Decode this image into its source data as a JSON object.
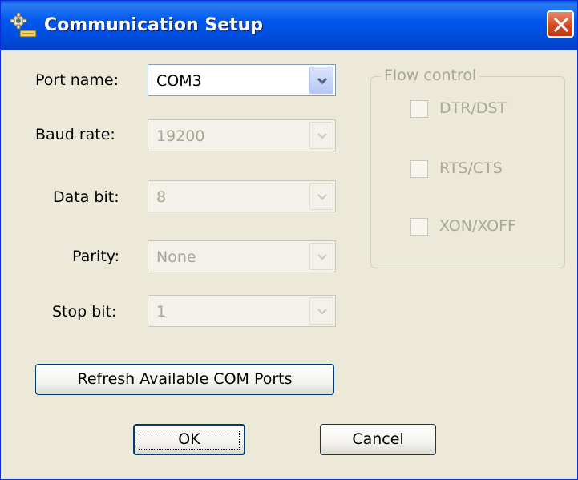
{
  "window": {
    "title": "Communication Setup",
    "title_icon": "settings-gear-icon",
    "close_icon": "close-icon"
  },
  "form": {
    "port_name": {
      "label": "Port name:",
      "value": "COM3",
      "enabled": true
    },
    "baud_rate": {
      "label": "Baud rate:",
      "value": "19200",
      "enabled": false
    },
    "data_bit": {
      "label": "Data bit:",
      "value": "8",
      "enabled": false
    },
    "parity": {
      "label": "Parity:",
      "value": "None",
      "enabled": false
    },
    "stop_bit": {
      "label": "Stop bit:",
      "value": "1",
      "enabled": false
    }
  },
  "flow_control": {
    "title": "Flow control",
    "options": [
      {
        "label": "DTR/DST",
        "checked": false,
        "enabled": false
      },
      {
        "label": "RTS/CTS",
        "checked": false,
        "enabled": false
      },
      {
        "label": "XON/XOFF",
        "checked": false,
        "enabled": false
      }
    ]
  },
  "buttons": {
    "refresh": "Refresh Available COM Ports",
    "ok": "OK",
    "cancel": "Cancel"
  },
  "colors": {
    "titlebar": "#0058ee",
    "dialog_bg": "#ece9d8",
    "close_button": "#d3461d",
    "disabled_text": "#a8a798"
  }
}
